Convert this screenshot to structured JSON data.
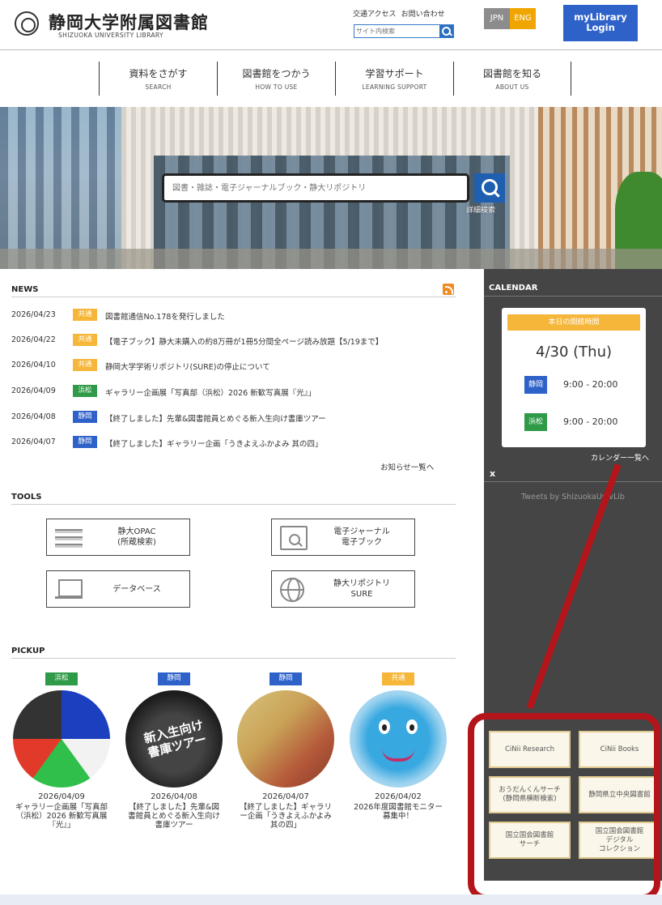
{
  "header": {
    "logo_ja": "静岡大学附属図書館",
    "logo_en": "SHIZUOKA UNIVERSITY LIBRARY",
    "access_link": "交通アクセス",
    "contact_link": "お問い合わせ",
    "site_search_placeholder": "サイト内検索",
    "lang_jpn": "JPN",
    "lang_eng": "ENG",
    "mylibrary": "myLibrary\nLogin"
  },
  "nav": [
    {
      "ja": "資料をさがす",
      "en": "SEARCH"
    },
    {
      "ja": "図書館をつかう",
      "en": "HOW TO USE"
    },
    {
      "ja": "学習サポート",
      "en": "LEARNING SUPPORT"
    },
    {
      "ja": "図書館を知る",
      "en": "ABOUT US"
    }
  ],
  "hero": {
    "search_placeholder": "図書・雑誌・電子ジャーナルブック・静大リポジトリ",
    "detail_search": "詳細検索"
  },
  "news": {
    "heading": "NEWS",
    "items": [
      {
        "date": "2026/04/23",
        "tag": "共通",
        "tag_type": "kyotsu",
        "title": "図書館通信No.178を発行しました"
      },
      {
        "date": "2026/04/22",
        "tag": "共通",
        "tag_type": "kyotsu",
        "title": "【電子ブック】静大未購入の約8万冊が1冊5分間全ページ読み放題【5/19まで】"
      },
      {
        "date": "2026/04/10",
        "tag": "共通",
        "tag_type": "kyotsu",
        "title": "静岡大学学術リポジトリ(SURE)の停止について"
      },
      {
        "date": "2026/04/09",
        "tag": "浜松",
        "tag_type": "hamamatsu",
        "title": "ギャラリー企画展「写真部（浜松）2026 新歓写真展『光』」"
      },
      {
        "date": "2026/04/08",
        "tag": "静岡",
        "tag_type": "shizuoka",
        "title": "【終了しました】先輩&図書館員とめぐる新入生向け書庫ツアー"
      },
      {
        "date": "2026/04/07",
        "tag": "静岡",
        "tag_type": "shizuoka",
        "title": "【終了しました】ギャラリー企画「うきよえふかよみ 其の四」"
      }
    ],
    "more": "お知らせ一覧へ"
  },
  "tools": {
    "heading": "TOOLS",
    "items": [
      {
        "label": "静大OPAC\n(所蔵検索)",
        "icon": "book-stack-icon"
      },
      {
        "label": "電子ジャーナル\n電子ブック",
        "icon": "page-search-icon"
      },
      {
        "label": "データベース",
        "icon": "laptop-icon"
      },
      {
        "label": "静大リポジトリ\nSURE",
        "icon": "globe-icon"
      }
    ]
  },
  "pickup": {
    "heading": "PICKUP",
    "items": [
      {
        "tag": "浜松",
        "tag_type": "hamamatsu",
        "date": "2026/04/09",
        "title": "ギャラリー企画展「写真部（浜松）2026 新歓写真展『光』」"
      },
      {
        "tag": "静岡",
        "tag_type": "shizuoka",
        "date": "2026/04/08",
        "title": "【終了しました】先輩&図書館員とめぐる新入生向け書庫ツアー",
        "image_text": "新入生向け\n書庫ツアー"
      },
      {
        "tag": "静岡",
        "tag_type": "shizuoka",
        "date": "2026/04/07",
        "title": "【終了しました】ギャラリー企画「うきよえふかよみ 其の四」"
      },
      {
        "tag": "共通",
        "tag_type": "kyotsu",
        "date": "2026/04/02",
        "title": "2026年度図書館モニター募集中！"
      }
    ]
  },
  "sidebar": {
    "calendar_heading": "CALENDAR",
    "today_label": "本日の開館時間",
    "today_date": "4/30 (Thu)",
    "hours": [
      {
        "campus": "静岡",
        "tag_type": "shizuoka",
        "hours": "9:00 - 20:00"
      },
      {
        "campus": "浜松",
        "tag_type": "hamamatsu",
        "hours": "9:00 - 20:00"
      }
    ],
    "calendar_more": "カレンダー一覧へ",
    "close": "x",
    "tweets": "Tweets by ShizuokaUnivLib",
    "links": [
      {
        "label": "CiNii Research"
      },
      {
        "label": "CiNii Books"
      },
      {
        "label": "おうだんくんサーチ\n(静岡県横断検索)"
      },
      {
        "label": "静岡県立中央図書館"
      },
      {
        "label": "国立国会図書館\nサーチ"
      },
      {
        "label": "国立国会図書館\nデジタル\nコレクション"
      }
    ]
  },
  "colors": {
    "kyotsu": "#f5b63a",
    "hamamatsu": "#2f9a48",
    "shizuoka": "#2f62c9",
    "annotation": "#b4151a"
  }
}
